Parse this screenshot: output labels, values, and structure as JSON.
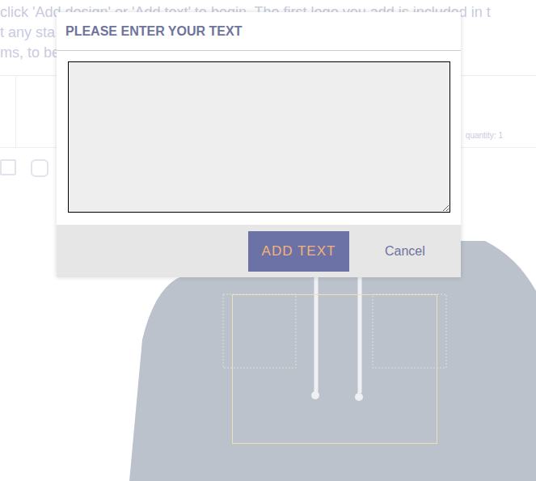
{
  "page": {
    "intro_lines": [
      "click 'Add design' or 'Add text' to begin. The first logo you add is included in t",
      "t any sta",
      "ms, to be"
    ],
    "quantity": "quantity: 1"
  },
  "dialog": {
    "title": "PLEASE ENTER YOUR TEXT",
    "text_field": {
      "value": ""
    },
    "buttons": [
      {
        "label": "ADD TEXT"
      },
      {
        "label": "Cancel"
      }
    ]
  }
}
